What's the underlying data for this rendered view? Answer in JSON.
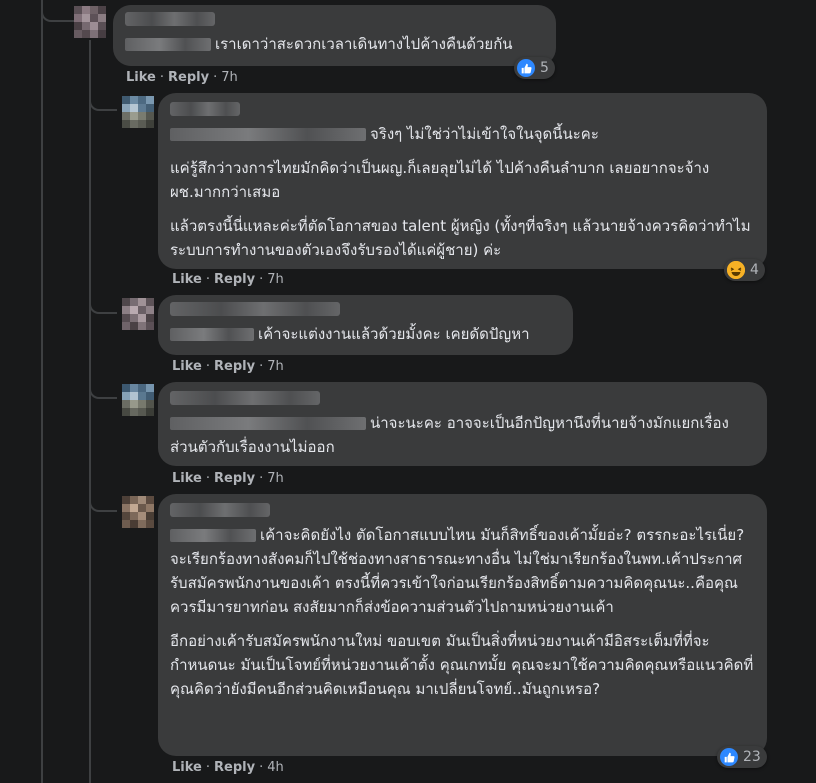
{
  "comments": [
    {
      "id": "c1",
      "author": "",
      "text": [
        "เราเดาว่าสะดวกเวลาเดินทางไปค้างคืนด้วยกัน"
      ],
      "actions": {
        "like": "Like",
        "reply": "Reply",
        "time": "7h"
      },
      "reaction": {
        "icon": "like-icon",
        "count": "5"
      }
    },
    {
      "id": "c2",
      "author": "",
      "text": [
        "จริงๆ ไม่ใช่ว่าไม่เข้าใจในจุดนี้นะคะ",
        "แค่รู้สึกว่าวงการไทยมักคิดว่าเป็นผญ.ก็เลยลุยไม่ได้ ไปค้างคืนลำบาก เลยอยากจะจ้างผช.มากกว่าเสมอ",
        "แล้วตรงนี้นี่แหละค่ะที่ตัดโอกาสของ talent ผู้หญิง (ทั้งๆที่จริงๆ แล้วนายจ้างควรคิดว่าทำไมระบบการทำงานของตัวเองจึงรับรองได้แค่ผู้ชาย) ค่ะ"
      ],
      "actions": {
        "like": "Like",
        "reply": "Reply",
        "time": "7h"
      },
      "reaction": {
        "icon": "haha-icon",
        "count": "4"
      }
    },
    {
      "id": "c3",
      "author": "",
      "text": [
        "เค้าจะแต่งงานแล้วด้วยมั้งคะ เคยดัดปัญหา"
      ],
      "actions": {
        "like": "Like",
        "reply": "Reply",
        "time": "7h"
      }
    },
    {
      "id": "c4",
      "author": "",
      "text": [
        "น่าจะนะคะ อาจจะเป็นอีกปัญหานึงที่นายจ้างมักแยกเรื่องส่วนตัวกับเรื่องงานไม่ออก"
      ],
      "actions": {
        "like": "Like",
        "reply": "Reply",
        "time": "7h"
      }
    },
    {
      "id": "c5",
      "author": "",
      "text": [
        "เค้าจะคิดยังไง ตัดโอกาสแบบไหน มันก็สิทธิ์ของเค้ามั้ยอ่ะ? ตรรกะอะไรเนี่ย? จะเรียกร้องทางสังคมก็ไปใช้ช่องทางสาธารณะทางอื่น ไม่ใช่มาเรียกร้องในพท.เค้าประกาศรับสมัครพนักงานของเค้า ตรงนี้ที่ควรเข้าใจก่อนเรียกร้องสิทธิ์ตามความคิดคุณนะ..คือคุณควรมีมารยาทก่อน สงสัยมากก็ส่งข้อความส่วนตัวไปถามหน่วยงานเค้า",
        "อีกอย่างเค้ารับสมัครพนักงานใหม่ ขอบเขต มันเป็นสิ่งที่หน่วยงานเค้ามีอิสระเต็มที่ที่จะกำหนดนะ มันเป็นโจทย์ที่หน่วยงานเค้าตั้ง คุณเกทมั้ย คุณจะมาใช้ความคิดคุณหรือแนวคิดที่คุณคิดว่ายังมีคนอีกส่วนคิดเหมือนคุณ มาเปลี่ยนโจทย์..มันถูกเหรอ?"
      ],
      "actions": {
        "like": "Like",
        "reply": "Reply",
        "time": "4h"
      },
      "reaction": {
        "icon": "like-icon",
        "count": "23"
      }
    }
  ],
  "colors": {
    "background": "#18191a",
    "bubble": "#3a3b3c",
    "text": "#e4e6eb",
    "secondary": "#b0b3b8",
    "like_blue": "#2d88ff",
    "haha_yellow": "#f7b125"
  }
}
